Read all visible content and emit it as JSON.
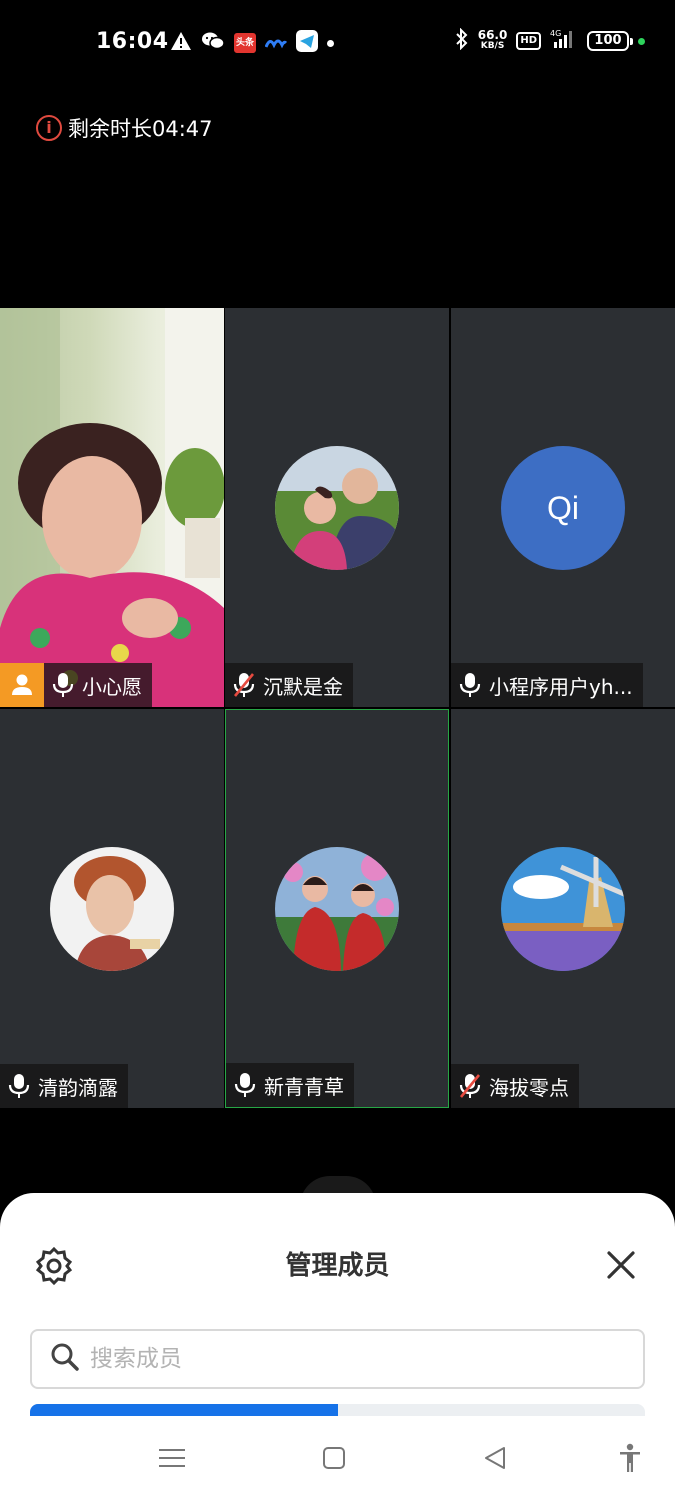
{
  "status_bar": {
    "time": "16:04",
    "speed_value": "66.0",
    "speed_unit": "KB/S",
    "hd_label": "HD",
    "network": "4G",
    "battery": "100",
    "left_icons": [
      "warning-icon",
      "wechat-icon",
      "toutiao-icon",
      "app-icon",
      "telegram-icon",
      "dot-icon"
    ],
    "toutiao_label": "头条"
  },
  "meeting": {
    "remaining_label": "剩余时长04:47"
  },
  "participants": [
    {
      "name": "小心愿",
      "mic": "on",
      "has_video": true,
      "is_host": true
    },
    {
      "name": "沉默是金",
      "mic": "muted",
      "has_video": false
    },
    {
      "name": "小程序用户yh...",
      "mic": "on",
      "has_video": false,
      "initials": "Qi"
    },
    {
      "name": "清韵滴露",
      "mic": "on",
      "has_video": false
    },
    {
      "name": "新青青草",
      "mic": "on",
      "has_video": false,
      "active_speaker": true
    },
    {
      "name": "海拔零点",
      "mic": "muted",
      "has_video": false
    }
  ],
  "sheet": {
    "title": "管理成员",
    "search_placeholder": "搜索成员",
    "progress": 0.5
  },
  "colors": {
    "tile_bg": "#2c2f33",
    "active_border": "#27a645",
    "host_badge": "#f49a24",
    "initials_bg": "#3d6ec4",
    "progress": "#1672e8",
    "warning": "#e04a3f"
  }
}
